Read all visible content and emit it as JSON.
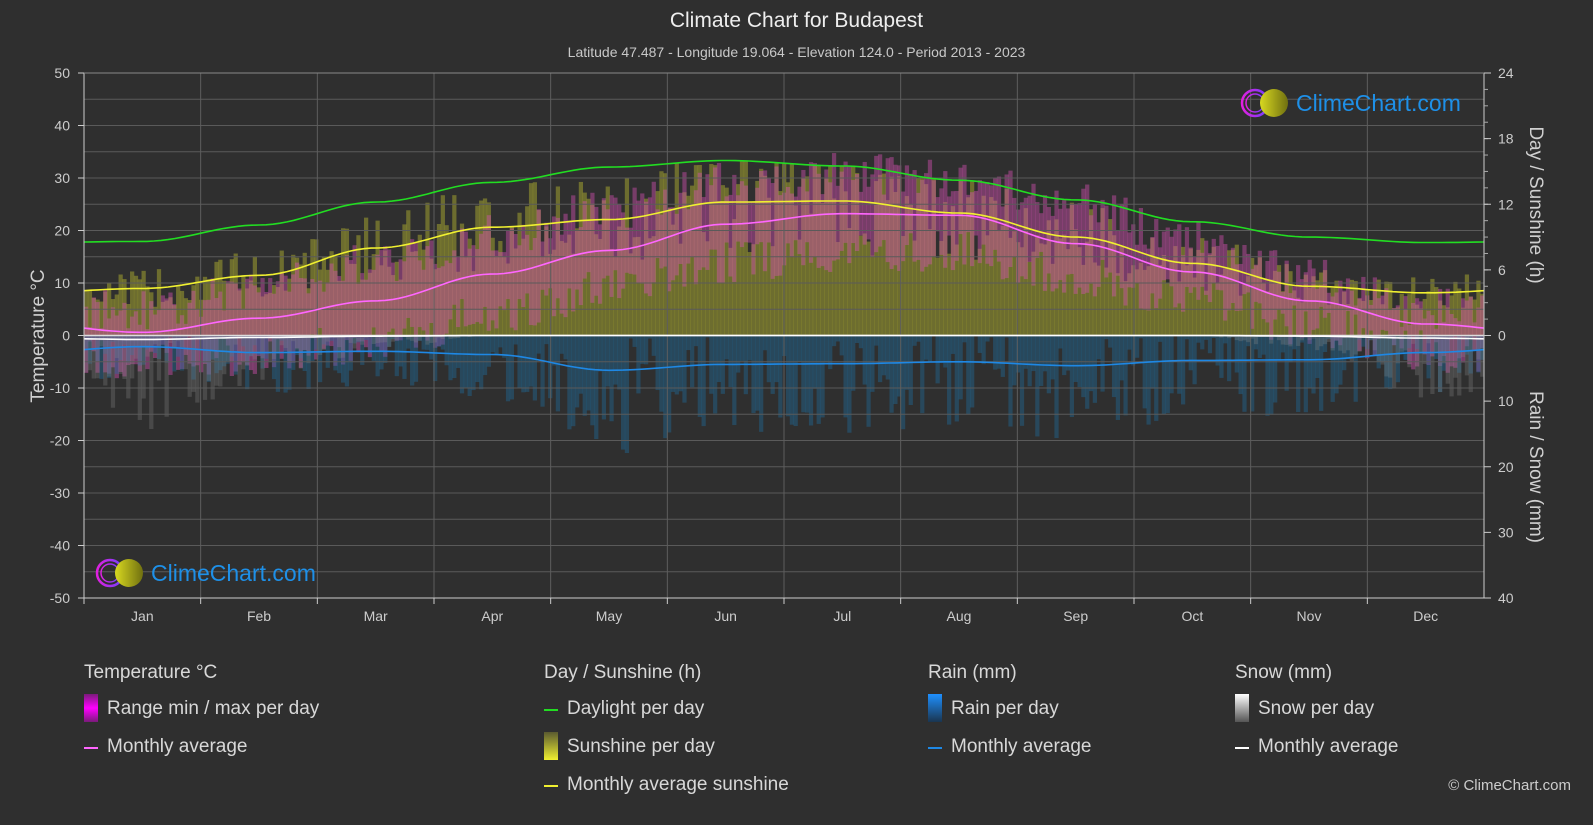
{
  "title": "Climate Chart for Budapest",
  "subtitle": "Latitude 47.487 - Longitude 19.064 - Elevation 124.0 - Period 2013 - 2023",
  "logo_text": "ClimeChart.com",
  "copyright": "© ClimeChart.com",
  "colors": {
    "background": "#2f2f2f",
    "temp_avg": "#ff66ff",
    "temp_range": "#e020e0",
    "daylight": "#22dd22",
    "sunshine_avg": "#f0f030",
    "sunshine_bar": "#a0a030",
    "rain_avg": "#1e88e5",
    "rain_bar": "#1e6fa0",
    "snow_avg": "#ffffff",
    "snow_bar": "#888888",
    "logo": "#1e90e8"
  },
  "legend": {
    "temperature": {
      "title": "Temperature °C",
      "items": [
        {
          "label": "Range min / max per day",
          "icon": "magenta-bar-swatch"
        },
        {
          "label": "Monthly average",
          "icon": "pink-line-swatch"
        }
      ]
    },
    "sunshine": {
      "title": "Day / Sunshine (h)",
      "items": [
        {
          "label": "Daylight per day",
          "icon": "green-line-swatch"
        },
        {
          "label": "Sunshine per day",
          "icon": "yellow-bar-swatch"
        },
        {
          "label": "Monthly average sunshine",
          "icon": "yellow-line-swatch"
        }
      ]
    },
    "rain": {
      "title": "Rain (mm)",
      "items": [
        {
          "label": "Rain per day",
          "icon": "blue-bar-swatch"
        },
        {
          "label": "Monthly average",
          "icon": "blue-line-swatch"
        }
      ]
    },
    "snow": {
      "title": "Snow (mm)",
      "items": [
        {
          "label": "Snow per day",
          "icon": "white-bar-swatch"
        },
        {
          "label": "Monthly average",
          "icon": "white-line-swatch"
        }
      ]
    }
  },
  "chart_data": {
    "type": "line",
    "title": "Climate Chart for Budapest",
    "categories": [
      "Jan",
      "Feb",
      "Mar",
      "Apr",
      "May",
      "Jun",
      "Jul",
      "Aug",
      "Sep",
      "Oct",
      "Nov",
      "Dec"
    ],
    "left_axis": {
      "label": "Temperature °C",
      "range": [
        -50,
        50
      ],
      "ticks": [
        50,
        40,
        30,
        20,
        10,
        0,
        -10,
        -20,
        -30,
        -40,
        -50
      ]
    },
    "right_axis_top": {
      "label": "Day / Sunshine (h)",
      "range": [
        0,
        24
      ],
      "ticks": [
        24,
        18,
        12,
        6,
        0
      ]
    },
    "right_axis_bottom": {
      "label": "Rain / Snow (mm)",
      "range": [
        0,
        40
      ],
      "ticks": [
        0,
        10,
        20,
        30,
        40
      ]
    },
    "grid": true,
    "legend_position": "bottom",
    "series": [
      {
        "name": "Temperature monthly average (°C)",
        "axis": "left",
        "values": [
          0.6,
          3.3,
          6.6,
          11.7,
          16.2,
          21.2,
          23.2,
          22.9,
          17.5,
          12.1,
          6.6,
          2.2
        ]
      },
      {
        "name": "Temperature daily max envelope (°C)",
        "axis": "left",
        "values": [
          5,
          9,
          14,
          19,
          24,
          29,
          31,
          30,
          25,
          18,
          11,
          5
        ]
      },
      {
        "name": "Temperature daily min envelope (°C)",
        "axis": "left",
        "values": [
          -5,
          -4,
          -1,
          4,
          9,
          14,
          16,
          16,
          11,
          7,
          2,
          -3
        ]
      },
      {
        "name": "Daylight per day (h)",
        "axis": "right_top",
        "values": [
          8.6,
          10.1,
          12.2,
          14.0,
          15.4,
          16.0,
          15.5,
          14.2,
          12.4,
          10.4,
          9.0,
          8.5
        ]
      },
      {
        "name": "Monthly average sunshine (h)",
        "axis": "right_top",
        "values": [
          4.3,
          5.5,
          8.0,
          9.9,
          10.6,
          12.2,
          12.3,
          11.2,
          9.0,
          6.6,
          4.5,
          3.9
        ]
      },
      {
        "name": "Rain monthly average (mm)",
        "axis": "right_bottom",
        "values": [
          1.7,
          2.6,
          2.4,
          2.9,
          5.3,
          4.4,
          4.3,
          4.0,
          4.6,
          3.8,
          3.7,
          2.6
        ]
      },
      {
        "name": "Snow monthly average (mm)",
        "axis": "right_bottom",
        "values": [
          0.6,
          0.3,
          0.1,
          0,
          0,
          0,
          0,
          0,
          0,
          0,
          0.1,
          0.4
        ]
      }
    ]
  }
}
